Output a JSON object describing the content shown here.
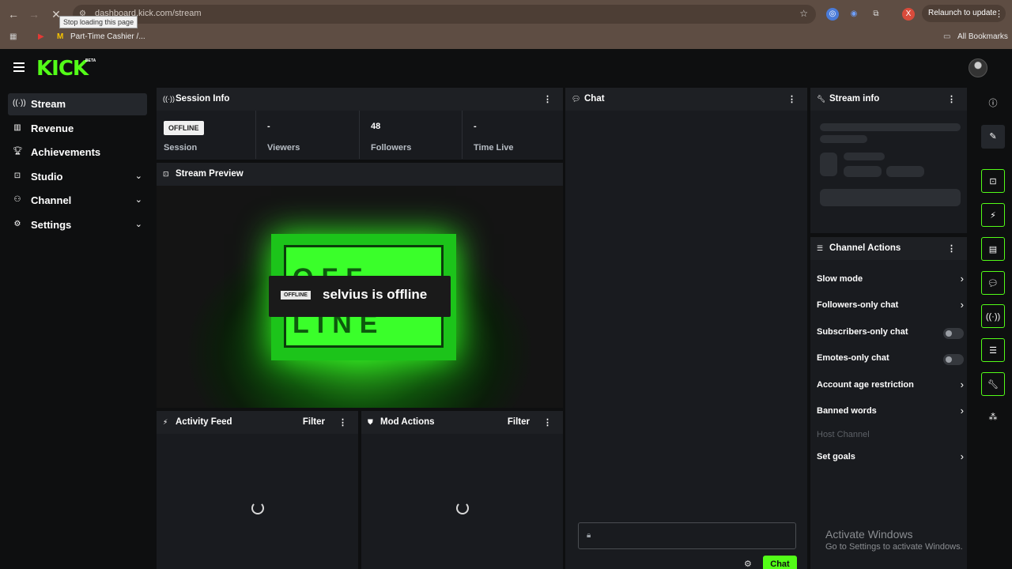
{
  "browser": {
    "url": "dashboard.kick.com/stream",
    "tooltip": "Stop loading this page",
    "relaunch_label": "Relaunch to update",
    "bookmark_label": "Part-Time Cashier /...",
    "all_bookmarks_label": "All Bookmarks",
    "icons": [
      "back-arrow-icon",
      "forward-arrow-icon",
      "stop-icon",
      "star-icon",
      "extension-icon",
      "kebab-icon"
    ]
  },
  "header": {
    "logo": "KICK",
    "beta": "BETA"
  },
  "sidebar": {
    "items": [
      {
        "label": "Stream",
        "icon": "broadcast-icon",
        "active": true
      },
      {
        "label": "Revenue",
        "icon": "chart-icon"
      },
      {
        "label": "Achievements",
        "icon": "trophy-icon"
      },
      {
        "label": "Studio",
        "icon": "studio-icon",
        "expandable": true
      },
      {
        "label": "Channel",
        "icon": "channel-icon",
        "expandable": true
      },
      {
        "label": "Settings",
        "icon": "gear-icon",
        "expandable": true
      }
    ]
  },
  "session": {
    "title": "Session Info",
    "badge": "OFFLINE",
    "session_label": "Session",
    "viewers_value": "-",
    "viewers_label": "Viewers",
    "followers_value": "48",
    "followers_label": "Followers",
    "timelive_value": "-",
    "timelive_label": "Time Live"
  },
  "preview": {
    "title": "Stream Preview",
    "sign_line1": "OFF",
    "sign_line2": "LINE",
    "offline_tag": "OFFLINE",
    "offline_text": "selvius is offline"
  },
  "activity": {
    "title": "Activity Feed",
    "filter": "Filter"
  },
  "mod": {
    "title": "Mod Actions",
    "filter": "Filter"
  },
  "chat": {
    "title": "Chat",
    "send": "Chat"
  },
  "stream_info": {
    "title": "Stream info"
  },
  "channel_actions": {
    "title": "Channel Actions",
    "items": [
      {
        "label": "Slow mode",
        "control": "arrow"
      },
      {
        "label": "Followers-only chat",
        "control": "arrow"
      },
      {
        "label": "Subscribers-only chat",
        "control": "toggle",
        "on": false
      },
      {
        "label": "Emotes-only chat",
        "control": "toggle",
        "on": false
      },
      {
        "label": "Account age restriction",
        "control": "arrow"
      },
      {
        "label": "Banned words",
        "control": "arrow"
      },
      {
        "label": "Host Channel",
        "control": "none",
        "disabled": true
      },
      {
        "label": "Set goals",
        "control": "arrow"
      }
    ]
  },
  "watermark": {
    "line1": "Activate Windows",
    "line2": "Go to Settings to activate Windows."
  },
  "colors": {
    "accent": "#53fc18",
    "panel": "#191b1f",
    "background": "#0e0f10"
  }
}
